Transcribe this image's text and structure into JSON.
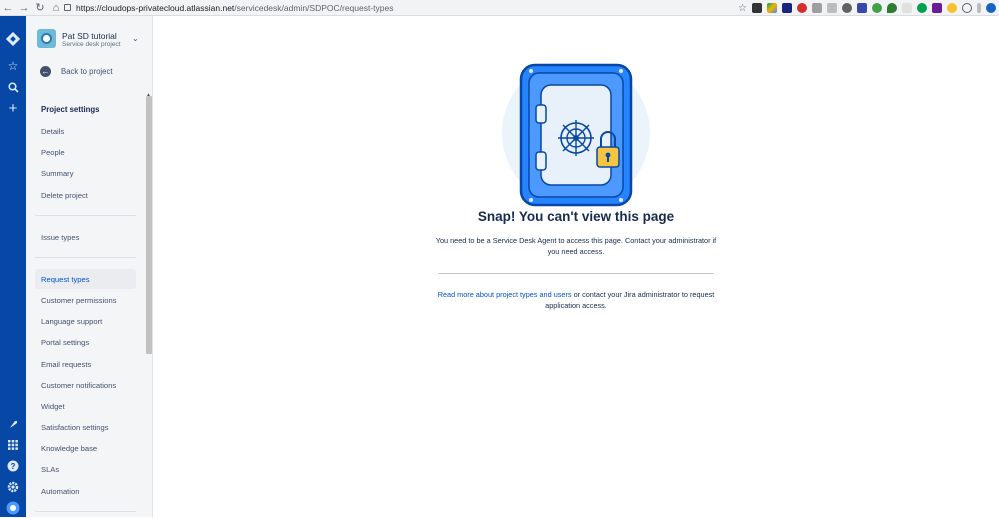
{
  "browser": {
    "url_host": "https://cloudops-privatecloud.atlassian.net",
    "url_path": "/servicedesk/admin/SDPOC/request-types"
  },
  "global_nav": {
    "icons": [
      "jira-logo-icon",
      "star-icon",
      "search-icon",
      "plus-icon",
      "rocket-icon",
      "app-switcher-icon",
      "help-icon",
      "settings-icon",
      "profile-avatar-icon"
    ]
  },
  "project": {
    "name": "Pat SD tutorial",
    "type": "Service desk project",
    "back_label": "Back to project"
  },
  "sidebar": {
    "heading": "Project settings",
    "group1": [
      "Details",
      "People",
      "Summary",
      "Delete project"
    ],
    "group2": [
      "Issue types"
    ],
    "group3": [
      "Request types",
      "Customer permissions",
      "Language support",
      "Portal settings",
      "Email requests",
      "Customer notifications",
      "Widget",
      "Satisfaction settings",
      "Knowledge base",
      "SLAs",
      "Automation"
    ],
    "active": "Request types"
  },
  "main": {
    "title": "Snap! You can't view this page",
    "description": "You need to be a Service Desk Agent to access this page. Contact your administrator if you need access.",
    "help_link": "Read more about project types and users",
    "help_text": " or contact your Jira administrator to request application access."
  },
  "colors": {
    "global_nav": "#0747A6",
    "sidebar_bg": "#F4F5F7",
    "link": "#0052CC",
    "vault_blue": "#2684FF",
    "lock_yellow": "#F5C542"
  }
}
